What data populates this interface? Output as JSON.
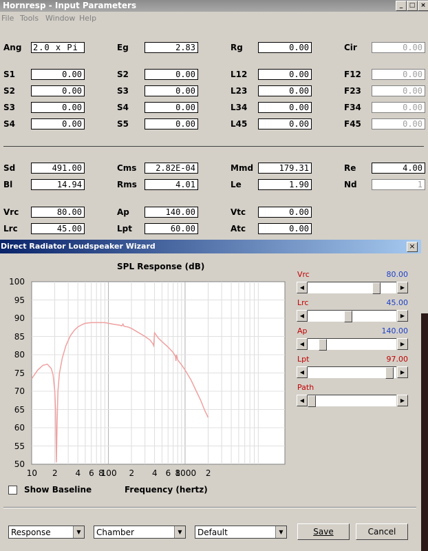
{
  "window": {
    "title": "Hornresp - Input Parameters"
  },
  "menu": [
    "File",
    "Tools",
    "Window",
    "Help"
  ],
  "window_buttons": [
    "_",
    "□",
    "×"
  ],
  "params": [
    {
      "label": "Ang",
      "value": "2.0 x Pi"
    },
    {
      "label": "Eg",
      "value": "2.83"
    },
    {
      "label": "Rg",
      "value": "0.00"
    },
    {
      "label": "Cir",
      "value": "0.00"
    },
    {
      "label": "S1",
      "value": "0.00"
    },
    {
      "label": "S2",
      "value": "0.00"
    },
    {
      "label": "L12",
      "value": "0.00"
    },
    {
      "label": "F12",
      "value": "0.00"
    },
    {
      "label": "S2",
      "value": "0.00"
    },
    {
      "label": "S3",
      "value": "0.00"
    },
    {
      "label": "L23",
      "value": "0.00"
    },
    {
      "label": "F23",
      "value": "0.00"
    },
    {
      "label": "S3",
      "value": "0.00"
    },
    {
      "label": "S4",
      "value": "0.00"
    },
    {
      "label": "L34",
      "value": "0.00"
    },
    {
      "label": "F34",
      "value": "0.00"
    },
    {
      "label": "S4",
      "value": "0.00"
    },
    {
      "label": "S5",
      "value": "0.00"
    },
    {
      "label": "L45",
      "value": "0.00"
    },
    {
      "label": "F45",
      "value": "0.00"
    },
    {
      "label": "Sd",
      "value": "491.00"
    },
    {
      "label": "Cms",
      "value": "2.82E-04"
    },
    {
      "label": "Mmd",
      "value": "179.31"
    },
    {
      "label": "Re",
      "value": "4.00"
    },
    {
      "label": "Bl",
      "value": "14.94"
    },
    {
      "label": "Rms",
      "value": "4.01"
    },
    {
      "label": "Le",
      "value": "1.90"
    },
    {
      "label": "Nd",
      "value": "1"
    },
    {
      "label": "Vrc",
      "value": "80.00"
    },
    {
      "label": "Ap",
      "value": "140.00"
    },
    {
      "label": "Vtc",
      "value": "0.00"
    },
    {
      "label": "Lrc",
      "value": "45.00"
    },
    {
      "label": "Lpt",
      "value": "60.00"
    },
    {
      "label": "Atc",
      "value": "0.00"
    }
  ],
  "wizard": {
    "title": "Direct Radiator Loudspeaker Wizard",
    "close": "×",
    "show_baseline": "Show Baseline",
    "sliders": [
      {
        "label": "Vrc",
        "value": "80.00",
        "fraction": 0.8
      },
      {
        "label": "Lrc",
        "value": "45.00",
        "fraction": 0.45
      },
      {
        "label": "Ap",
        "value": "140.00",
        "fraction": 0.14
      },
      {
        "label": "Lpt",
        "value": "97.00",
        "fraction": 0.97
      },
      {
        "label": "Path",
        "value": "",
        "fraction": 0.0
      }
    ],
    "combos": [
      "Response",
      "Chamber",
      "Default"
    ],
    "save": "Save",
    "cancel": "Cancel",
    "colors": {
      "curve": "#f0a0a0",
      "label_red": "#c00000",
      "value_blue": "#1c3fc8",
      "title_bar_start": "#0a246a"
    }
  },
  "chart_data": {
    "type": "line",
    "title": "SPL Response (dB)",
    "xlabel": "Frequency (hertz)",
    "ylabel": "",
    "x_scale": "log",
    "xlim": [
      10,
      20000
    ],
    "ylim": [
      50,
      100
    ],
    "yticks": [
      "100",
      "95",
      "90",
      "85",
      "80",
      "75",
      "70",
      "65",
      "60",
      "55",
      "50"
    ],
    "xticks": [
      "10",
      "2",
      "4",
      "6",
      "8",
      "100",
      "2",
      "4",
      "6",
      "8",
      "1000",
      "2"
    ],
    "grid": true,
    "series": [
      {
        "x": [
          10,
          12,
          14,
          16,
          18,
          19,
          20,
          20.5,
          21,
          21.5,
          22,
          23,
          25,
          28,
          32,
          36,
          40,
          45,
          50,
          60,
          70,
          80,
          90,
          100,
          120,
          140,
          150,
          155,
          160,
          180,
          200,
          250,
          300,
          350,
          380,
          390,
          400,
          450,
          500,
          600,
          700,
          750,
          760,
          770,
          800,
          900,
          1000,
          1200,
          1400,
          1600,
          1800,
          2000
        ],
        "y": [
          73.4,
          75.8,
          77.1,
          77.4,
          76.2,
          74.5,
          70.0,
          65.0,
          50.5,
          62.0,
          70.0,
          74.8,
          79.0,
          82.5,
          85.2,
          86.7,
          87.6,
          88.2,
          88.6,
          88.8,
          88.8,
          88.8,
          88.8,
          88.6,
          88.3,
          88.1,
          87.9,
          88.4,
          87.8,
          87.6,
          87.2,
          86.0,
          85.0,
          84.0,
          83.0,
          82.5,
          86.0,
          84.5,
          83.6,
          82.1,
          80.6,
          79.5,
          78.3,
          80.0,
          78.6,
          77.2,
          75.8,
          73.0,
          70.0,
          67.5,
          64.8,
          62.8
        ]
      }
    ]
  }
}
